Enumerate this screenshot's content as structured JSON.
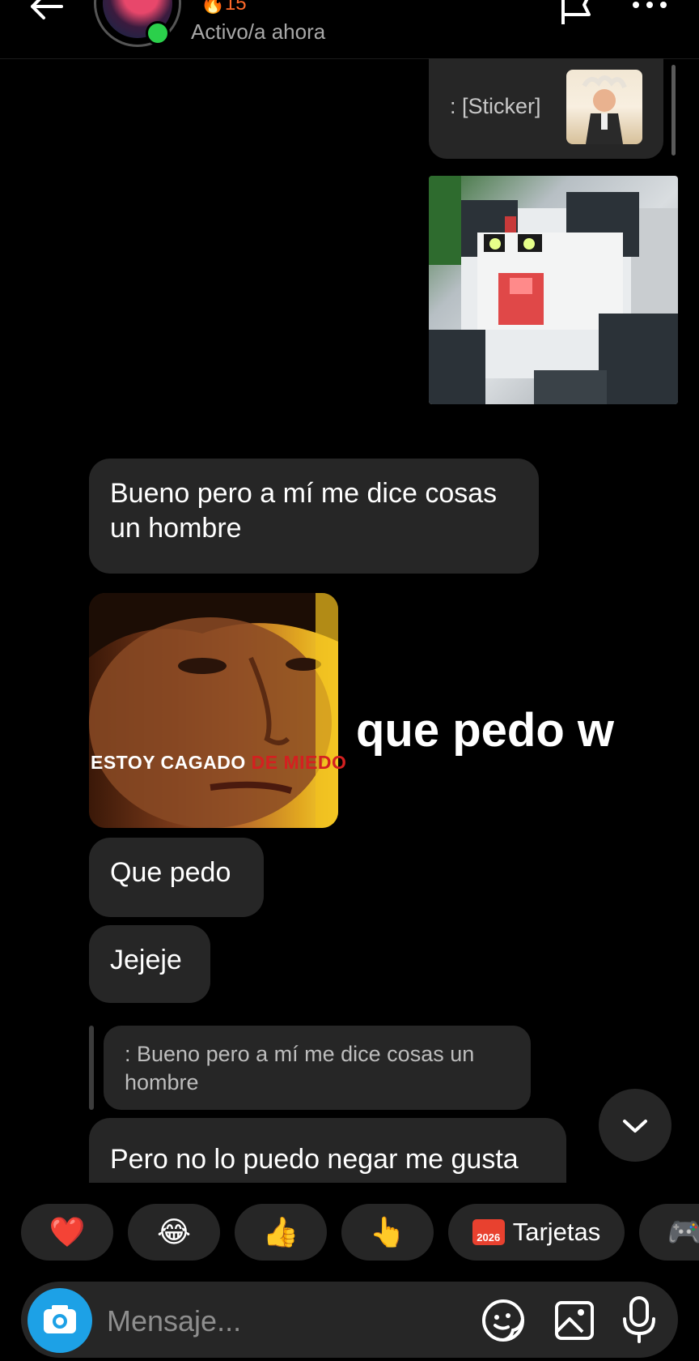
{
  "header": {
    "streak_count": "15",
    "status": "Activo/a ahora"
  },
  "messages": {
    "sticker_label": ": [Sticker]",
    "msg1": "Bueno pero a mí me dice cosas un hombre",
    "face_caption_white": "ESTOY CAGADO ",
    "face_caption_red": "DE MIEDO",
    "overlay_text": "que pedo w",
    "msg2": "Que pedo",
    "msg3": "Jejeje",
    "reply_quote": ": Bueno pero a mí me dice cosas un hombre",
    "msg4": "Pero no lo puedo negar me gusta"
  },
  "quick_reactions": {
    "heart": "❤️",
    "laugh": "😂",
    "thumbs_up": "👍",
    "point": "👆",
    "cards_icon_text": "2026",
    "cards_label": "Tarjetas",
    "game": "🎮"
  },
  "composer": {
    "placeholder": "Mensaje..."
  },
  "colors": {
    "background": "#000000",
    "bubble": "#262626",
    "online": "#2bd04b",
    "camera": "#1da1e6",
    "streak": "#ff6a2a"
  }
}
